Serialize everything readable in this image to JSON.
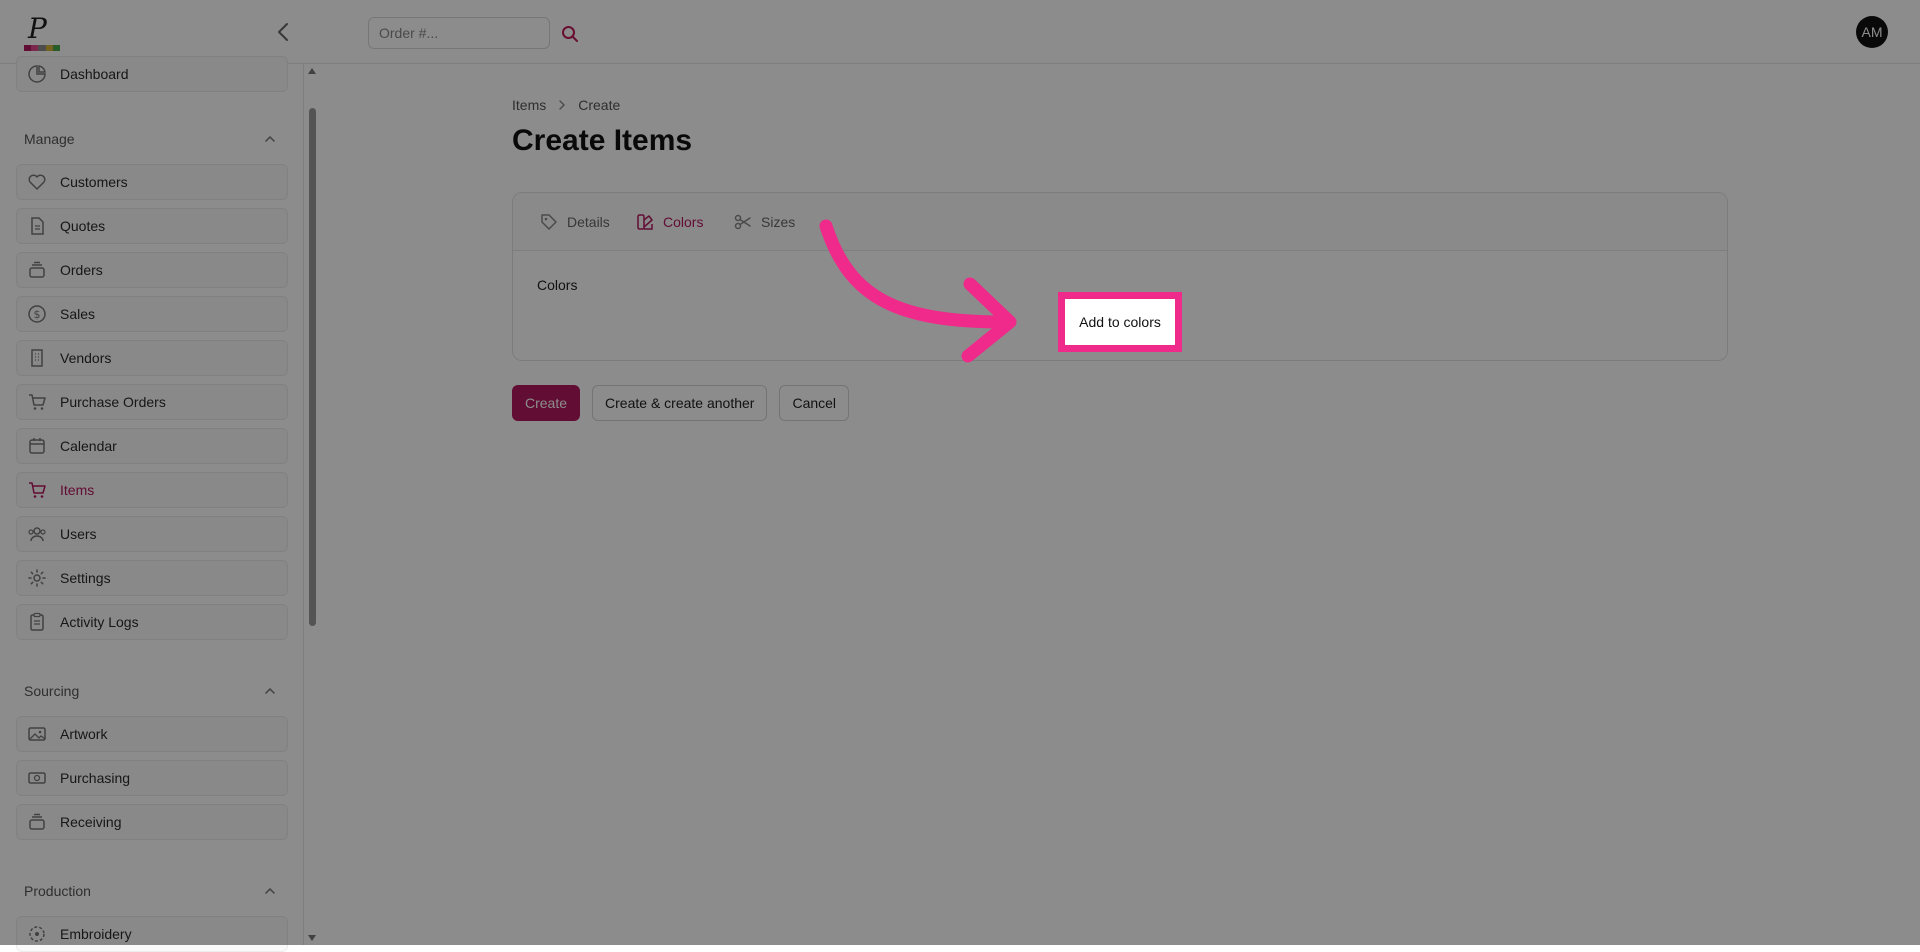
{
  "header": {
    "search_placeholder": "Order #...",
    "avatar_initials": "AM",
    "logo_colors": [
      "#b3185e",
      "#e04a8a",
      "#8b8b8b",
      "#d8b23a",
      "#4aa84a"
    ]
  },
  "sidebar": {
    "top_item": "Dashboard",
    "sections": [
      {
        "label": "Manage"
      },
      {
        "label": "Sourcing"
      },
      {
        "label": "Production"
      }
    ],
    "manage_items": [
      "Customers",
      "Quotes",
      "Orders",
      "Sales",
      "Vendors",
      "Purchase Orders",
      "Calendar",
      "Items",
      "Users",
      "Settings",
      "Activity Logs"
    ],
    "sourcing_items": [
      "Artwork",
      "Purchasing",
      "Receiving"
    ],
    "production_items": [
      "Embroidery"
    ],
    "active_item": "Items"
  },
  "breadcrumb": {
    "items": [
      "Items",
      "Create"
    ]
  },
  "page": {
    "title": "Create Items"
  },
  "tabs": [
    {
      "label": "Details",
      "icon": "tag-icon"
    },
    {
      "label": "Colors",
      "icon": "swatch-icon"
    },
    {
      "label": "Sizes",
      "icon": "scissors-icon"
    }
  ],
  "active_tab": "Colors",
  "form": {
    "colors_label": "Colors",
    "add_button_label": "Add to colors"
  },
  "actions": {
    "create": "Create",
    "create_another": "Create & create another",
    "cancel": "Cancel"
  },
  "colors": {
    "accent": "#b3185e",
    "highlight": "#f02a8a"
  }
}
